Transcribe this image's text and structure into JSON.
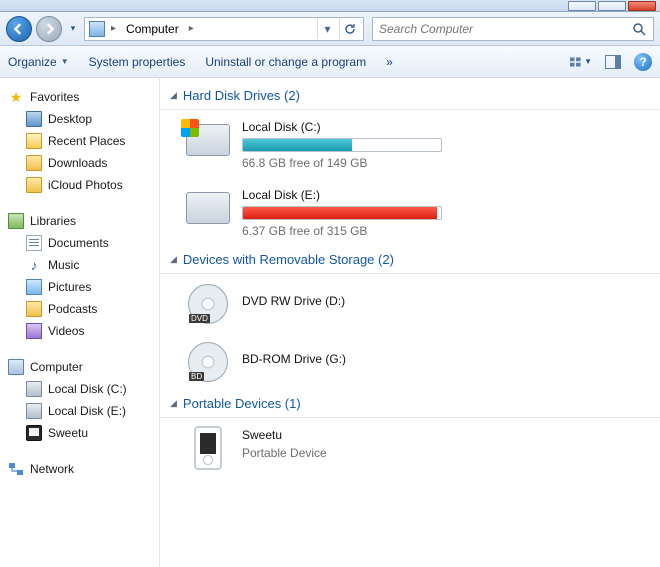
{
  "breadcrumb": {
    "location": "Computer"
  },
  "search": {
    "placeholder": "Search Computer"
  },
  "toolbar": {
    "organize": "Organize",
    "system_properties": "System properties",
    "uninstall": "Uninstall or change a program",
    "overflow": "»"
  },
  "sidebar": {
    "favorites": {
      "label": "Favorites",
      "items": [
        {
          "label": "Desktop"
        },
        {
          "label": "Recent Places"
        },
        {
          "label": "Downloads"
        },
        {
          "label": "iCloud Photos"
        }
      ]
    },
    "libraries": {
      "label": "Libraries",
      "items": [
        {
          "label": "Documents"
        },
        {
          "label": "Music"
        },
        {
          "label": "Pictures"
        },
        {
          "label": "Podcasts"
        },
        {
          "label": "Videos"
        }
      ]
    },
    "computer": {
      "label": "Computer",
      "items": [
        {
          "label": "Local Disk (C:)"
        },
        {
          "label": "Local Disk (E:)"
        },
        {
          "label": "Sweetu"
        }
      ]
    },
    "network": {
      "label": "Network"
    }
  },
  "categories": {
    "hdd": {
      "label": "Hard Disk Drives (2)",
      "drives": [
        {
          "name": "Local Disk (C:)",
          "free_text": "66.8 GB free of 149 GB",
          "used_percent": 55,
          "color": "teal"
        },
        {
          "name": "Local Disk (E:)",
          "free_text": "6.37 GB free of 315 GB",
          "used_percent": 98,
          "color": "red"
        }
      ]
    },
    "removable": {
      "label": "Devices with Removable Storage (2)",
      "drives": [
        {
          "name": "DVD RW Drive (D:)",
          "tag": "DVD"
        },
        {
          "name": "BD-ROM Drive (G:)",
          "tag": "BD"
        }
      ]
    },
    "portable": {
      "label": "Portable Devices (1)",
      "devices": [
        {
          "name": "Sweetu",
          "type": "Portable Device"
        }
      ]
    }
  }
}
